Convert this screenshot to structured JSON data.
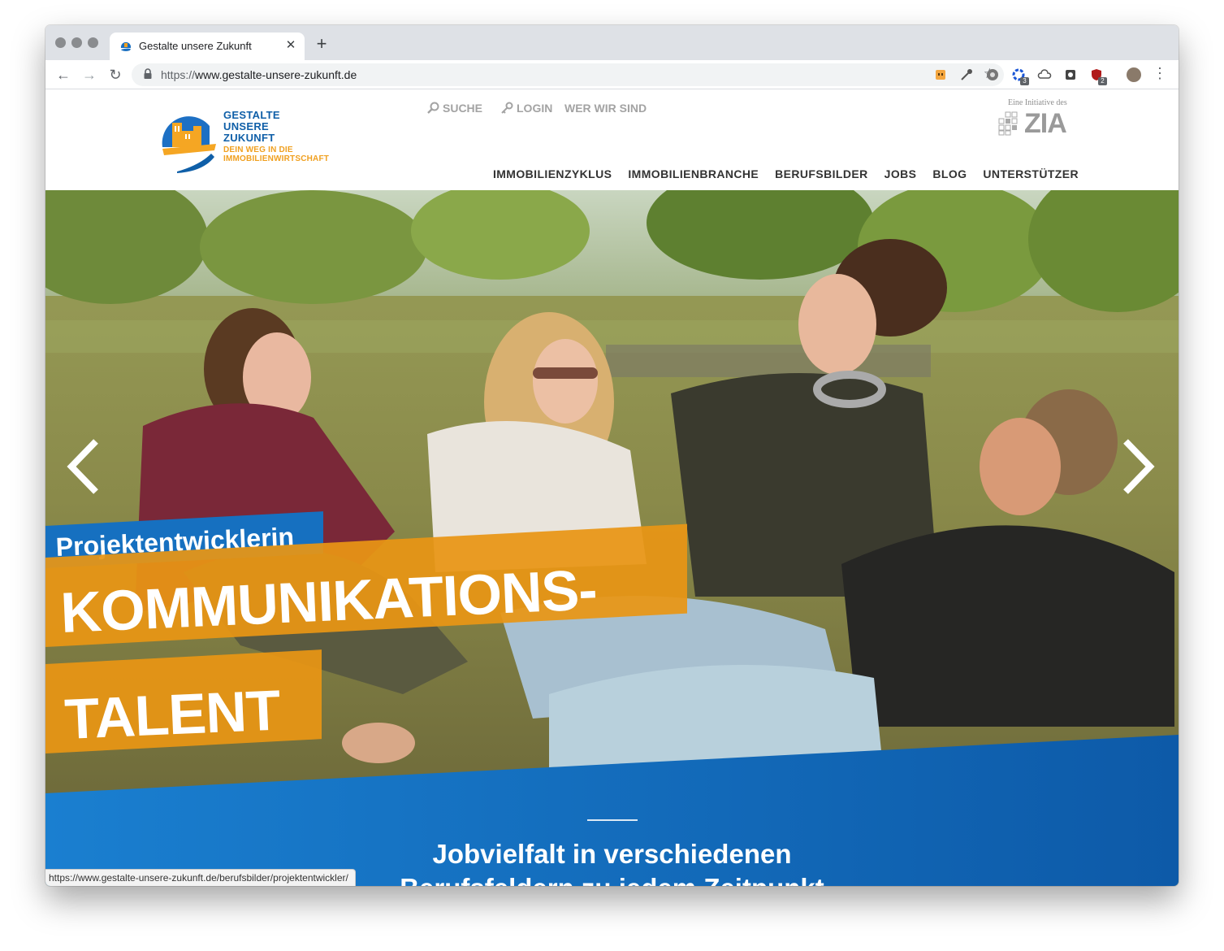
{
  "browser": {
    "tab_title": "Gestalte unsere Zukunft",
    "close_glyph": "✕",
    "new_tab_glyph": "+",
    "url_scheme": "https://",
    "url_host": "www.gestalte-unsere-zukunft.de",
    "back_glyph": "←",
    "forward_glyph": "→",
    "reload_glyph": "↻",
    "star_glyph": "☆",
    "menu_glyph": "⋮",
    "extensions": [
      {
        "name": "extension-icon",
        "badge": ""
      },
      {
        "name": "eyedropper-icon",
        "badge": ""
      },
      {
        "name": "gear-extension-icon",
        "badge": ""
      },
      {
        "name": "blue-ring-extension-icon",
        "badge": "3"
      },
      {
        "name": "cloud-icon",
        "badge": ""
      },
      {
        "name": "shield-extension-icon",
        "badge": ""
      },
      {
        "name": "red-shield-extension-icon",
        "badge": "2"
      }
    ],
    "status_url": "https://www.gestalte-unsere-zukunft.de/berufsbilder/projektentwickler/"
  },
  "site": {
    "logo": {
      "line1": "GESTALTE",
      "line2": "UNSERE",
      "line3": "ZUKUNFT",
      "tag1": "DEIN WEG IN DIE",
      "tag2": "IMMOBILIENWIRTSCHAFT"
    },
    "meta_nav": {
      "search": "SUCHE",
      "login": "LOGIN",
      "about": "WER WIR SIND"
    },
    "zia": {
      "caption": "Eine Initiative des",
      "word": "ZIA"
    },
    "main_nav": [
      "IMMOBILIENZYKLUS",
      "IMMOBILIENBRANCHE",
      "BERUFSBILDER",
      "JOBS",
      "BLOG",
      "UNTERSTÜTZER"
    ]
  },
  "hero": {
    "role": "Projektentwicklerin",
    "headline_line1": "KOMMUNIKATIONS-",
    "headline_line2": "TALENT",
    "section_heading_line1": "Jobvielfalt in verschiedenen",
    "section_heading_line2": "Berufsfeldern zu jedem Zeitpunkt"
  },
  "colors": {
    "brand_blue": "#0f5fa8",
    "brand_orange": "#e89614",
    "band_blue_left": "#1a7fd0",
    "band_blue_right": "#0d5aa8"
  }
}
